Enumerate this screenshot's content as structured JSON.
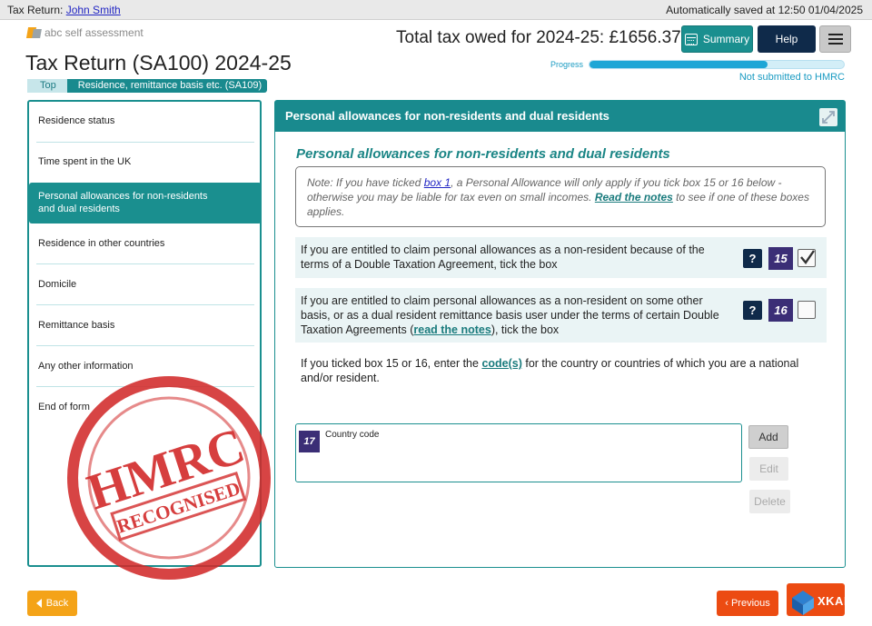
{
  "topbar": {
    "prefix": "Tax Return:",
    "user_name": "John Smith",
    "autosave": "Automatically saved at 12:50 01/04/2025"
  },
  "brand": {
    "logo_text": "abc self assessment",
    "logo_icon": "abc-logo-icon"
  },
  "header": {
    "title": "Tax Return (SA100) 2024-25",
    "total_tax": "Total tax owed for 2024-25: £1656.37",
    "summary_label": "Summary",
    "help_label": "Help",
    "progress_label": "Progress",
    "progress_value": 0.7,
    "status": "Not submitted to HMRC"
  },
  "breadcrumb": {
    "top": "Top",
    "current": "Residence, remittance basis etc. (SA109)"
  },
  "sidebar": {
    "items": [
      {
        "label": "Residence status",
        "active": false
      },
      {
        "label": "Time spent in the UK",
        "active": false
      },
      {
        "label": "Personal allowances for non-residents and dual residents",
        "active": true
      },
      {
        "label": "Residence in other countries",
        "active": false
      },
      {
        "label": "Domicile",
        "active": false
      },
      {
        "label": "Remittance basis",
        "active": false
      },
      {
        "label": "Any other information",
        "active": false
      },
      {
        "label": "End of form",
        "active": false
      }
    ]
  },
  "panel": {
    "header": "Personal allowances for non-residents and dual residents",
    "subtitle": "Personal allowances for non-residents and dual residents",
    "note": {
      "part1": "Note: If you have ticked ",
      "link1": "box 1",
      "part2": ", a Personal Allowance will only apply if you tick box 15 or 16 below - otherwise you may be liable for tax even on small incomes. ",
      "link2": "Read the notes",
      "part3": " to see if one of these boxes applies."
    },
    "questions": [
      {
        "text": "If you are entitled to claim personal allowances as a non-resident because of the terms of a Double Taxation Agreement, tick the box",
        "box": "15",
        "checked": true
      },
      {
        "text_before": "If you are entitled to claim personal allowances as a non-resident on some other basis, or as a dual resident remittance basis user under the terms of certain Double Taxation Agreements (",
        "link": "read the notes",
        "text_after": "), tick the box",
        "box": "16",
        "checked": false
      }
    ],
    "help_mark": "?",
    "country_question": {
      "before": "If you ticked box 15 or 16, enter the ",
      "link": "code(s)",
      "after": " for the country or countries of which you are a national and/or resident."
    },
    "country_box": {
      "box": "17",
      "label": "Country code"
    },
    "add_label": "Add",
    "edit_label": "Edit",
    "delete_label": "Delete"
  },
  "footer": {
    "back_label": "Back",
    "previous_label": "‹ Previous"
  },
  "overlays": {
    "stamp_line1": "HMRC",
    "stamp_line2": "RECOGNISED",
    "stamp_color": "#d22a2a",
    "watermark_text": "XKARE"
  },
  "colors": {
    "teal": "#198a8e",
    "navy": "#0f2a4a",
    "box_purple": "#3b2e76",
    "orange": "#f4a318",
    "red_orange": "#ec4b12",
    "progress_blue": "#1ea6d6"
  }
}
